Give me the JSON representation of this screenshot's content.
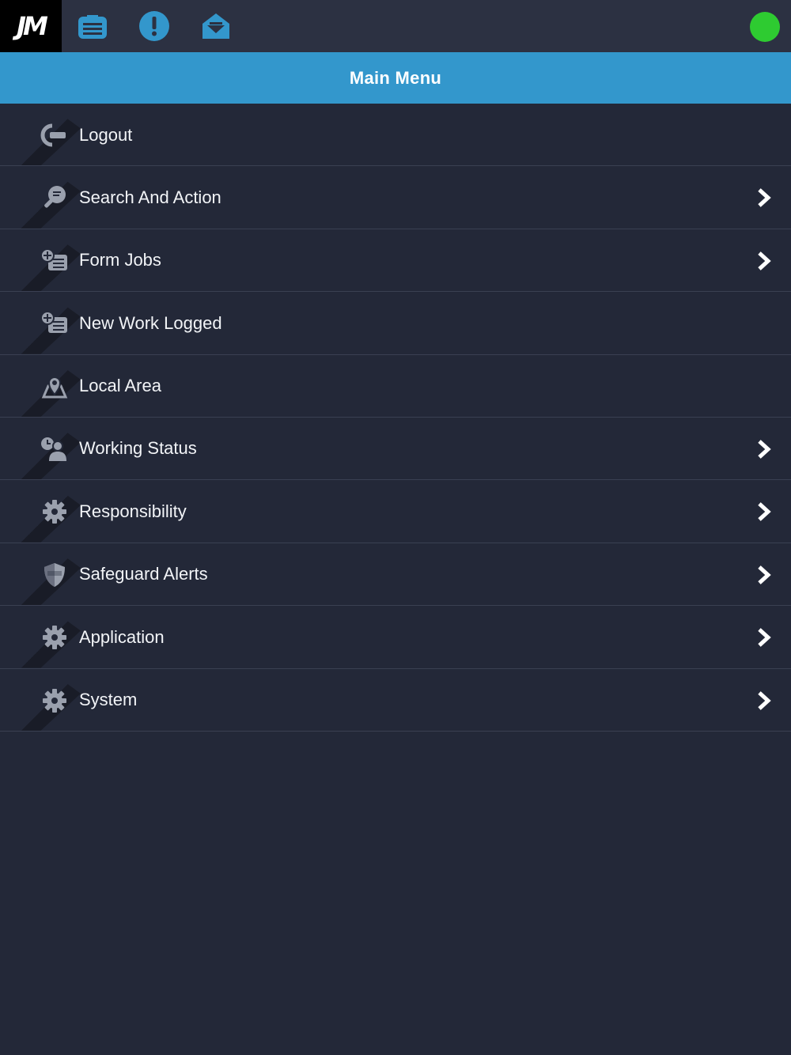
{
  "topbar": {
    "logo_text": "JM",
    "icons": [
      "list-icon",
      "alert-icon",
      "inbox-icon"
    ],
    "status_color": "#2ecb31"
  },
  "title": "Main Menu",
  "colors": {
    "background": "#232838",
    "topbar": "#2c3142",
    "accent": "#3397cc",
    "status_online": "#2ecb31"
  },
  "menu": {
    "items": [
      {
        "label": "Logout",
        "icon": "logout-icon",
        "has_chevron": false
      },
      {
        "label": "Search And Action",
        "icon": "search-icon",
        "has_chevron": true
      },
      {
        "label": "Form Jobs",
        "icon": "add-form-icon",
        "has_chevron": true
      },
      {
        "label": "New Work Logged",
        "icon": "add-form-icon",
        "has_chevron": false
      },
      {
        "label": "Local Area",
        "icon": "map-pin-icon",
        "has_chevron": false
      },
      {
        "label": "Working Status",
        "icon": "user-clock-icon",
        "has_chevron": true
      },
      {
        "label": "Responsibility",
        "icon": "gear-icon",
        "has_chevron": true
      },
      {
        "label": "Safeguard Alerts",
        "icon": "shield-icon",
        "has_chevron": true
      },
      {
        "label": "Application",
        "icon": "gear-icon",
        "has_chevron": true
      },
      {
        "label": "System",
        "icon": "gear-icon",
        "has_chevron": true
      }
    ]
  }
}
